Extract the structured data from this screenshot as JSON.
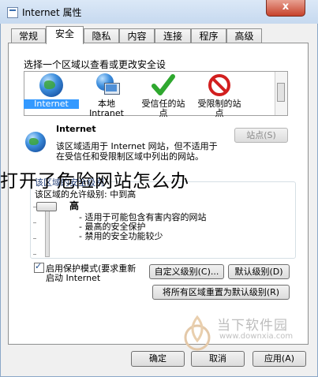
{
  "window": {
    "title": "Internet 属性",
    "close_label": "x"
  },
  "tabs": [
    {
      "label": "常规"
    },
    {
      "label": "安全"
    },
    {
      "label": "隐私"
    },
    {
      "label": "内容"
    },
    {
      "label": "连接"
    },
    {
      "label": "程序"
    },
    {
      "label": "高级"
    }
  ],
  "security": {
    "prompt": "选择一个区域以查看或更改安全设",
    "zones": [
      {
        "line1": "Internet",
        "line2": "",
        "icon": "globe-icon"
      },
      {
        "line1": "本地",
        "line2": "Intranet",
        "icon": "intranet-icon"
      },
      {
        "line1": "受信任的站",
        "line2": "点",
        "icon": "check-icon"
      },
      {
        "line1": "受限制的站",
        "line2": "点",
        "icon": "restricted-icon"
      }
    ],
    "selected_zone_title": "Internet",
    "zone_desc_line1": "该区域适用于 Internet 网站，但不适用于",
    "zone_desc_line2": "在受信任和受限制区域中列出的网站。",
    "sites_button": "站点(S)",
    "level_group_title": "该区域的安全级别",
    "allowed_level": "该区域的允许级别: 中到高",
    "level_name": "高",
    "level_points": [
      "- 适用于可能包含有害内容的网站",
      "- 最高的安全保护",
      "- 禁用的安全功能较少"
    ],
    "protected_mode_line1": "启用保护模式(要求重新",
    "protected_mode_line2": "启动 Internet",
    "custom_level_button": "自定义级别(C)...",
    "default_level_button": "默认级别(D)",
    "reset_all_button": "将所有区域重置为默认级别(R)"
  },
  "footer": {
    "ok": "确定",
    "cancel": "取消",
    "apply": "应用(A)"
  },
  "overlay_caption": "打开了危险网站怎么办",
  "watermark": {
    "brand": "当下软件园",
    "url": "www.downxia.com"
  }
}
